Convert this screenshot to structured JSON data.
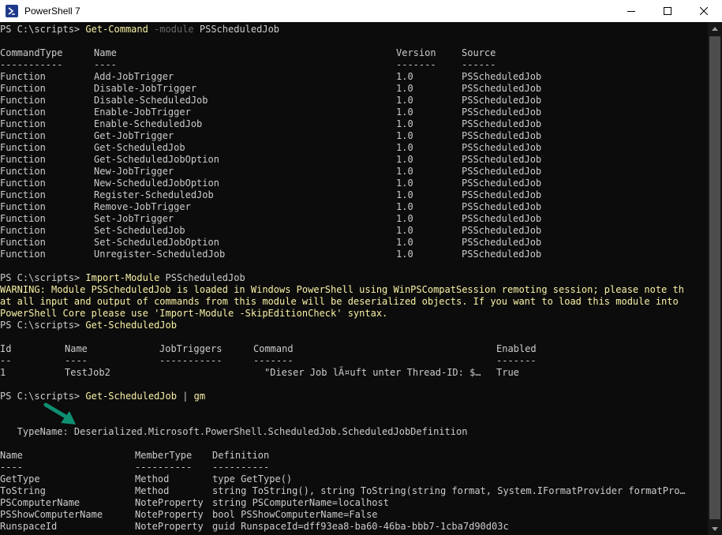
{
  "window": {
    "title": "PowerShell 7",
    "icon": "powershell-icon",
    "controls": [
      "minimize-icon",
      "maximize-icon",
      "close-icon"
    ]
  },
  "colors": {
    "background": "#0c0c0c",
    "text": "#cccccc",
    "command": "#f9f1a5",
    "parameter": "#767676",
    "warning": "#f9f1a5",
    "arrow": "#0f8f72"
  },
  "prompt": "PS C:\\scripts> ",
  "cmd1": {
    "name": "Get-Command",
    "param": "-module",
    "arg": "PSScheduledJob"
  },
  "gc_header": {
    "col1": "CommandType",
    "col2": "Name",
    "col3": "Version",
    "col4": "Source",
    "sep1": "-----------",
    "sep2": "----",
    "sep3": "-------",
    "sep4": "------"
  },
  "commands": [
    [
      "Function",
      "Add-JobTrigger",
      "1.0",
      "PSScheduledJob"
    ],
    [
      "Function",
      "Disable-JobTrigger",
      "1.0",
      "PSScheduledJob"
    ],
    [
      "Function",
      "Disable-ScheduledJob",
      "1.0",
      "PSScheduledJob"
    ],
    [
      "Function",
      "Enable-JobTrigger",
      "1.0",
      "PSScheduledJob"
    ],
    [
      "Function",
      "Enable-ScheduledJob",
      "1.0",
      "PSScheduledJob"
    ],
    [
      "Function",
      "Get-JobTrigger",
      "1.0",
      "PSScheduledJob"
    ],
    [
      "Function",
      "Get-ScheduledJob",
      "1.0",
      "PSScheduledJob"
    ],
    [
      "Function",
      "Get-ScheduledJobOption",
      "1.0",
      "PSScheduledJob"
    ],
    [
      "Function",
      "New-JobTrigger",
      "1.0",
      "PSScheduledJob"
    ],
    [
      "Function",
      "New-ScheduledJobOption",
      "1.0",
      "PSScheduledJob"
    ],
    [
      "Function",
      "Register-ScheduledJob",
      "1.0",
      "PSScheduledJob"
    ],
    [
      "Function",
      "Remove-JobTrigger",
      "1.0",
      "PSScheduledJob"
    ],
    [
      "Function",
      "Set-JobTrigger",
      "1.0",
      "PSScheduledJob"
    ],
    [
      "Function",
      "Set-ScheduledJob",
      "1.0",
      "PSScheduledJob"
    ],
    [
      "Function",
      "Set-ScheduledJobOption",
      "1.0",
      "PSScheduledJob"
    ],
    [
      "Function",
      "Unregister-ScheduledJob",
      "1.0",
      "PSScheduledJob"
    ]
  ],
  "cmd2": {
    "name": "Import-Module",
    "arg": "PSScheduledJob"
  },
  "warning_lines": [
    "WARNING: Module PSScheduledJob is loaded in Windows PowerShell using WinPSCompatSession remoting session; please note th",
    "at all input and output of commands from this module will be deserialized objects. If you want to load this module into",
    "PowerShell Core please use 'Import-Module -SkipEditionCheck' syntax."
  ],
  "cmd3": {
    "name": "Get-ScheduledJob"
  },
  "job_header": {
    "col1": "Id",
    "col2": "Name",
    "col3": "JobTriggers",
    "col4": "Command",
    "col5": "Enabled",
    "sep1": "--",
    "sep2": "----",
    "sep3": "-----------",
    "sep4": "-------",
    "sep5": "-------"
  },
  "jobs": [
    [
      "1",
      "TestJob2",
      "",
      "\"Dieser Job lÃ¤uft unter Thread-ID: $…",
      "True"
    ]
  ],
  "cmd4": {
    "name": "Get-ScheduledJob",
    "pipe": "|",
    "arg": "gm"
  },
  "typename": "   TypeName: Deserialized.Microsoft.PowerShell.ScheduledJob.ScheduledJobDefinition",
  "gm_header": {
    "col1": "Name",
    "col2": "MemberType",
    "col3": "Definition",
    "sep1": "----",
    "sep2": "----------",
    "sep3": "----------"
  },
  "members": [
    [
      "GetType",
      "Method",
      "type GetType()"
    ],
    [
      "ToString",
      "Method",
      "string ToString(), string ToString(string format, System.IFormatProvider formatPro…"
    ],
    [
      "PSComputerName",
      "NoteProperty",
      "string PSComputerName=localhost"
    ],
    [
      "PSShowComputerName",
      "NoteProperty",
      "bool PSShowComputerName=False"
    ],
    [
      "RunspaceId",
      "NoteProperty",
      "guid RunspaceId=dff93ea8-ba60-46ba-bbb7-1cba7d90d03c"
    ]
  ]
}
